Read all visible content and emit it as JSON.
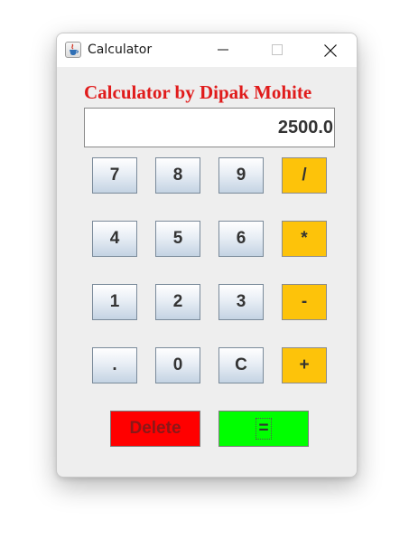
{
  "window": {
    "title": "Calculator",
    "icon": "java-cup-icon",
    "controls": [
      "minimize-icon",
      "maximize-icon",
      "close-icon"
    ]
  },
  "app": {
    "heading": "Calculator by Dipak Mohite",
    "display_value": "2500.0"
  },
  "keypad": {
    "row1": [
      "7",
      "8",
      "9",
      "/"
    ],
    "row2": [
      "4",
      "5",
      "6",
      "*"
    ],
    "row3": [
      "1",
      "2",
      "3",
      "-"
    ],
    "row4": [
      ".",
      "0",
      "C",
      "+"
    ]
  },
  "actions": {
    "delete_label": "Delete",
    "equals_label": "="
  },
  "colors": {
    "heading": "#e01b1b",
    "operator": "#fdc30a",
    "delete": "#ff0000",
    "equals": "#00ff00"
  }
}
